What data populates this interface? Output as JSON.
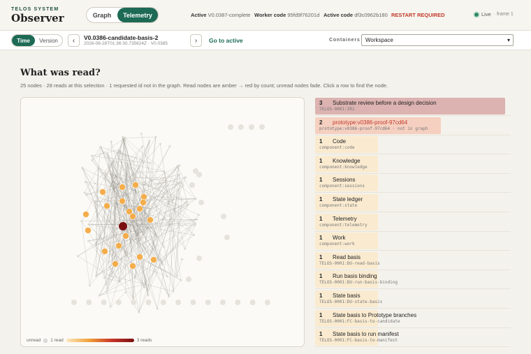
{
  "header": {
    "brand_small": "TELOS SYSTEM",
    "brand_big": "Observer",
    "tabs": [
      "Graph",
      "Telemetry"
    ],
    "active_label": "Active",
    "active_value": "V0.0387-complete",
    "worker_label": "Worker code",
    "worker_value": "95fd9f76201d",
    "active_code_label": "Active code",
    "active_code_value": "df3c0962b180",
    "restart": "RESTART REQUIRED",
    "live": "Live",
    "frame": "· frame 1"
  },
  "toolbar": {
    "mode_tabs": [
      "Time",
      "Version"
    ],
    "prev": "‹",
    "next": "›",
    "basis_name": "V0.0386-candidate-basis-2",
    "basis_sub": "2026-08-28T01:36:30.735624Z · V0.0385",
    "goto": "Go to active",
    "containers_label": "Containers",
    "containers_value": "Workspace"
  },
  "main": {
    "title": "What was read?",
    "subtitle": "25 nodes · 28 reads at this selection · 1 requested id not in the graph. Read nodes are amber → red by count; unread nodes fade. Click a row to find the node."
  },
  "legend": {
    "unread": "unread",
    "one": "1 read",
    "max": "3 reads"
  },
  "colors": {
    "accent": "#1d6a55",
    "restart": "#c0392b",
    "hot": "#7a0f10",
    "amber": "#f2a23a"
  },
  "reads": [
    {
      "count": "3",
      "label": "Substrate review before a design decision",
      "id": "TELOS-0001:IR1",
      "fill": 1.0,
      "color": "#dcb3b1"
    },
    {
      "count": "2",
      "label": "prototype:v0386-proof-97cd64",
      "id": "prototype:v0386-proof-97cd64 · not in graph",
      "fill": 0.66,
      "color": "#f5d0c0",
      "missing": true
    },
    {
      "count": "1",
      "label": "Code",
      "id": "component:code",
      "fill": 0.33,
      "color": "#faebd0"
    },
    {
      "count": "1",
      "label": "Knowledge",
      "id": "component:knowledge",
      "fill": 0.33,
      "color": "#faebd0"
    },
    {
      "count": "1",
      "label": "Sessions",
      "id": "component:sessions",
      "fill": 0.33,
      "color": "#faebd0"
    },
    {
      "count": "1",
      "label": "State ledger",
      "id": "component:state",
      "fill": 0.33,
      "color": "#faebd0"
    },
    {
      "count": "1",
      "label": "Telemetry",
      "id": "component:telemetry",
      "fill": 0.33,
      "color": "#faebd0"
    },
    {
      "count": "1",
      "label": "Work",
      "id": "component:work",
      "fill": 0.33,
      "color": "#faebd0"
    },
    {
      "count": "1",
      "label": "Read basis",
      "id": "TELOS-0001:DU-read-basis",
      "fill": 0.33,
      "color": "#faebd0"
    },
    {
      "count": "1",
      "label": "Run basis binding",
      "id": "TELOS-0001:DU-run-basis-binding",
      "fill": 0.33,
      "color": "#faebd0"
    },
    {
      "count": "1",
      "label": "State basis",
      "id": "TELOS-0001:DU-state-basis",
      "fill": 0.33,
      "color": "#faebd0"
    },
    {
      "count": "1",
      "label": "State basis to Prototype branches",
      "id": "TELOS-0001:FC-basis-to-candidate",
      "fill": 0.33,
      "color": "#faebd0"
    },
    {
      "count": "1",
      "label": "State basis to run manifest",
      "id": "TELOS-0001:FC-basis-to-manifest",
      "fill": 0.33,
      "color": "#faebd0"
    }
  ]
}
